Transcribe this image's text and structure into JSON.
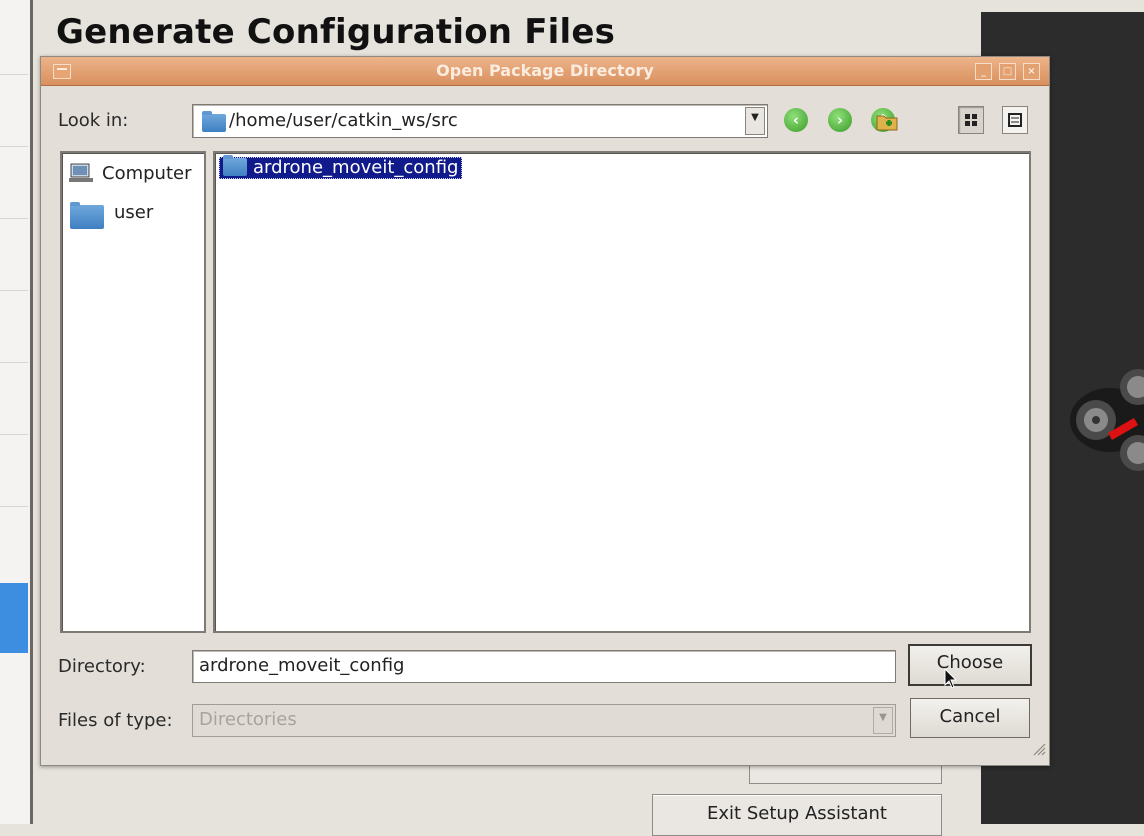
{
  "background": {
    "page_title": "Generate Configuration Files",
    "exit_button": "Exit Setup Assistant"
  },
  "dialog": {
    "title": "Open Package Directory",
    "look_in_label": "Look in:",
    "look_in_path": "/home/user/catkin_ws/src",
    "sidebar": [
      {
        "label": "Computer",
        "icon": "computer-icon"
      },
      {
        "label": "user",
        "icon": "folder-icon"
      }
    ],
    "files": [
      {
        "name": "ardrone_moveit_config",
        "selected": true
      }
    ],
    "directory_label": "Directory:",
    "directory_value": "ardrone_moveit_config",
    "file_type_label": "Files of type:",
    "file_type_value": "Directories",
    "choose_button": "Choose",
    "cancel_button": "Cancel"
  },
  "colors": {
    "titlebar": "#d9905e",
    "selection": "#101a8a",
    "nav_icon": "#3a9a28"
  }
}
